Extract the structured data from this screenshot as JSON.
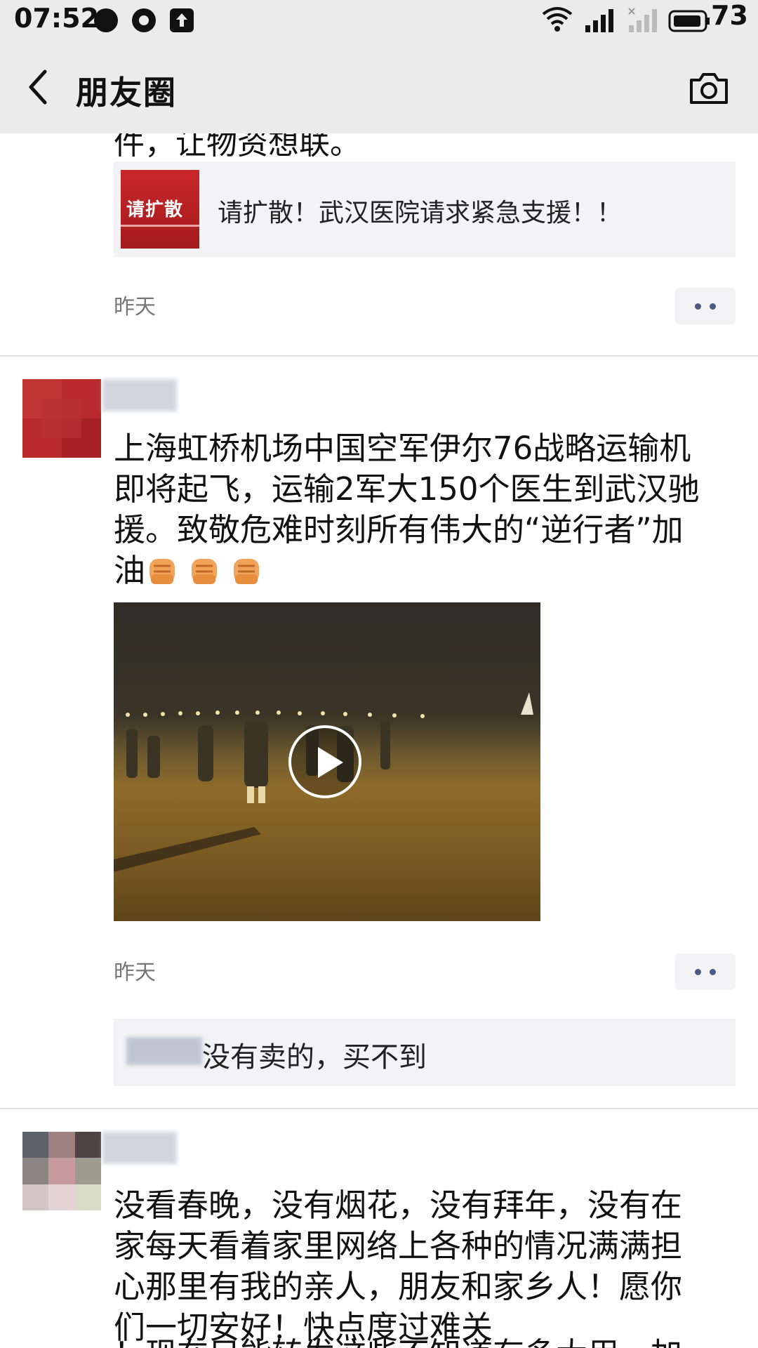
{
  "status_bar": {
    "time": "07:52",
    "battery": "73",
    "icons": [
      "notification-icon",
      "droplet-icon",
      "upload-icon",
      "wifi-icon",
      "signal-icon",
      "signal-nosim-icon",
      "battery-icon"
    ]
  },
  "header": {
    "title": "朋友圈",
    "back_icon": "chevron-left-icon",
    "camera_icon": "camera-icon"
  },
  "posts": [
    {
      "cut_text": "件，让物资想联。",
      "link": {
        "thumb_text": "请扩散",
        "title": "请扩散！武汉医院请求紧急支援！！"
      },
      "time": "昨天"
    },
    {
      "text": "上海虹桥机场中国空军伊尔76战略运输机即将起飞，运输2军大150个医生到武汉驰援。致敬危难时刻所有伟大的“逆行者”加油",
      "emoji": [
        "fist-emoji",
        "fist-emoji",
        "fist-emoji"
      ],
      "video": {
        "icon": "play-icon"
      },
      "time": "昨天",
      "comment": {
        "text": "没有卖的，买不到"
      }
    },
    {
      "text": "没看春晚，没有烟花，没有拜年，没有在家每天看着家里网络上各种的情况满满担心那里有我的亲人，朋友和家乡人！愿你们一切安好！快点度过难关",
      "cut_text": "！现在只能转发这些不知道有多大用，加"
    }
  ],
  "colors": {
    "header_bg": "#ebebeb",
    "link_bg": "#f3f3f5",
    "more_dots": "#4b5b84",
    "thumb_red": "#c9282b"
  }
}
